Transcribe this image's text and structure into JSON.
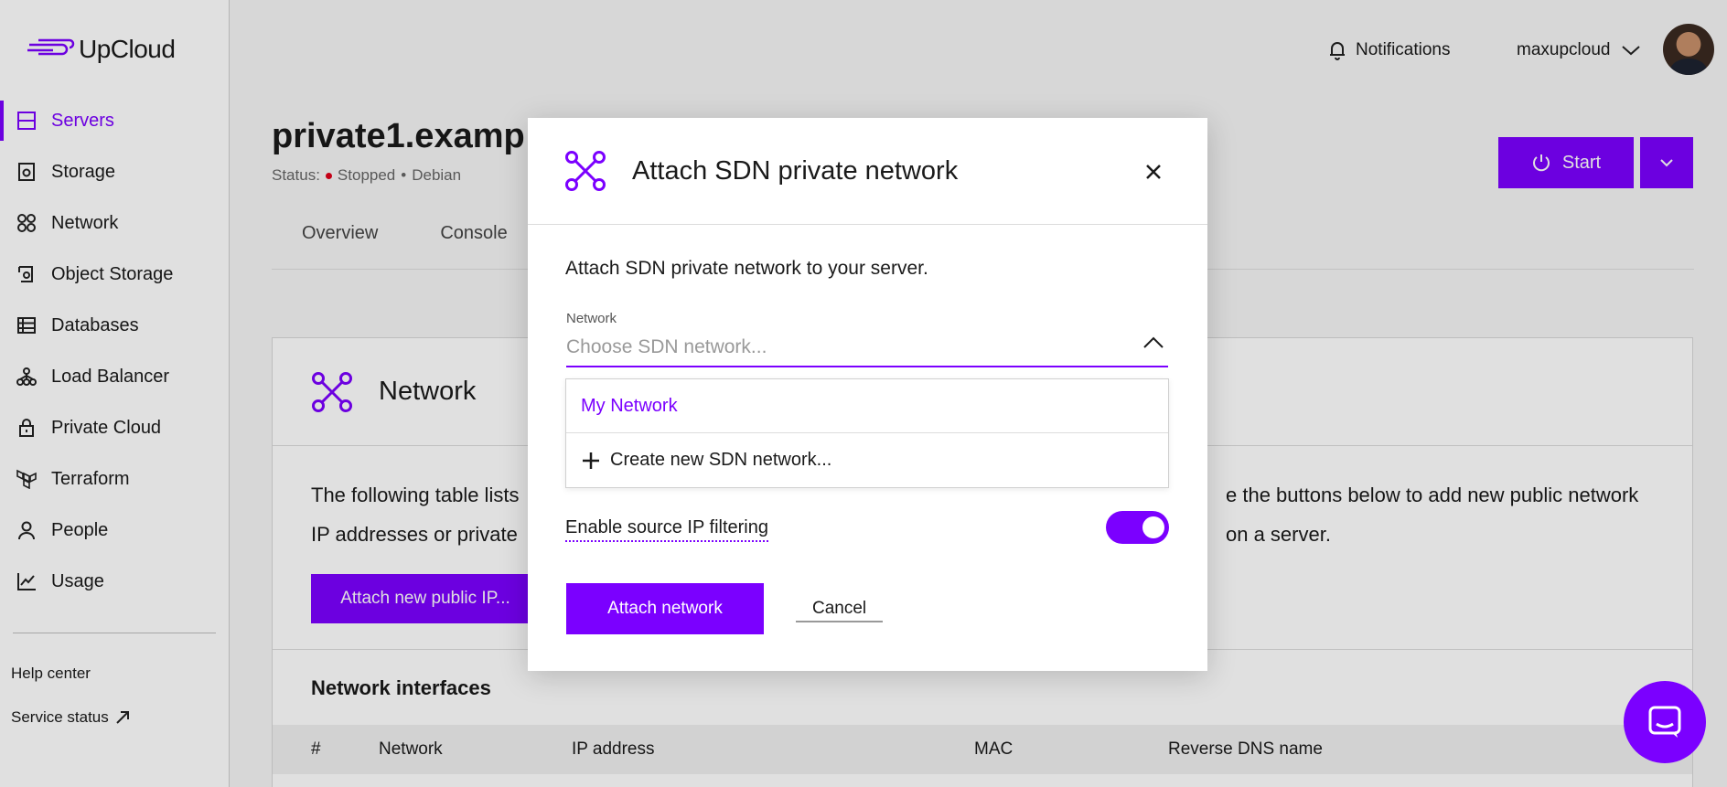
{
  "brand": {
    "name": "UpCloud",
    "accent": "#7b00ff"
  },
  "sidebar": {
    "items": [
      {
        "label": "Servers",
        "icon": "servers-icon",
        "active": true
      },
      {
        "label": "Storage",
        "icon": "storage-icon"
      },
      {
        "label": "Network",
        "icon": "network-icon"
      },
      {
        "label": "Object Storage",
        "icon": "object-storage-icon"
      },
      {
        "label": "Databases",
        "icon": "databases-icon"
      },
      {
        "label": "Load Balancer",
        "icon": "load-balancer-icon"
      },
      {
        "label": "Private Cloud",
        "icon": "lock-icon"
      },
      {
        "label": "Terraform",
        "icon": "terraform-icon"
      },
      {
        "label": "People",
        "icon": "person-icon"
      },
      {
        "label": "Usage",
        "icon": "chart-icon"
      }
    ],
    "help_center": "Help center",
    "service_status": "Service status"
  },
  "topbar": {
    "notifications": "Notifications",
    "username": "maxupcloud"
  },
  "server": {
    "title": "private1.examp",
    "status_label": "Status:",
    "status": "Stopped",
    "os": "Debian",
    "start_label": "Start"
  },
  "tabs": [
    "Overview",
    "Console"
  ],
  "network_card": {
    "title": "Network",
    "text_line1_left": "The following table lists",
    "text_line2_left": "IP addresses or private",
    "text_line1_right": "e the buttons below to add new public network",
    "text_line2_right": "on a server.",
    "attach_public_ip": "Attach new public IP...",
    "interfaces_title": "Network interfaces",
    "columns": [
      "#",
      "Network",
      "IP address",
      "MAC",
      "Reverse DNS name"
    ]
  },
  "modal": {
    "title": "Attach SDN private network",
    "description": "Attach SDN private network to your server.",
    "network_label": "Network",
    "network_placeholder": "Choose SDN network...",
    "options": [
      "My Network"
    ],
    "create_option": "Create new SDN network...",
    "filter_label": "Enable source IP filtering",
    "filter_enabled": true,
    "attach_button": "Attach network",
    "cancel_button": "Cancel"
  }
}
